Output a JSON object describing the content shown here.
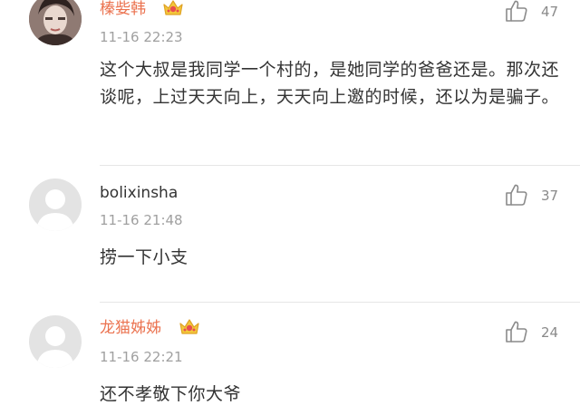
{
  "comments": [
    {
      "username": "榛姕韩",
      "time": "11-16 22:23",
      "text": "这个大叔是我同学一个村的，是她同学的爸爸还是。那次还谈呢，上过天天向上，天天向上邀的时候，还以为是骗子。",
      "likes": "47",
      "avatar": "photo",
      "vip": true
    },
    {
      "username": "bolixinsha",
      "time": "11-16 21:48",
      "text": "捞一下小支",
      "likes": "37",
      "avatar": "default",
      "vip": false
    },
    {
      "username": "龙猫姊姊",
      "time": "11-16 22:21",
      "text": "还不孝敬下你大爷",
      "likes": "24",
      "avatar": "default",
      "vip": true
    }
  ],
  "colors": {
    "vip_username": "#eb7350",
    "username": "#333333",
    "timestamp": "#a0a0a0",
    "like_icon": "#8a8a8a"
  },
  "icons": {
    "like": "thumbs-up-icon",
    "vip": "crown-badge-icon",
    "default_avatar": "user-silhouette-icon"
  }
}
